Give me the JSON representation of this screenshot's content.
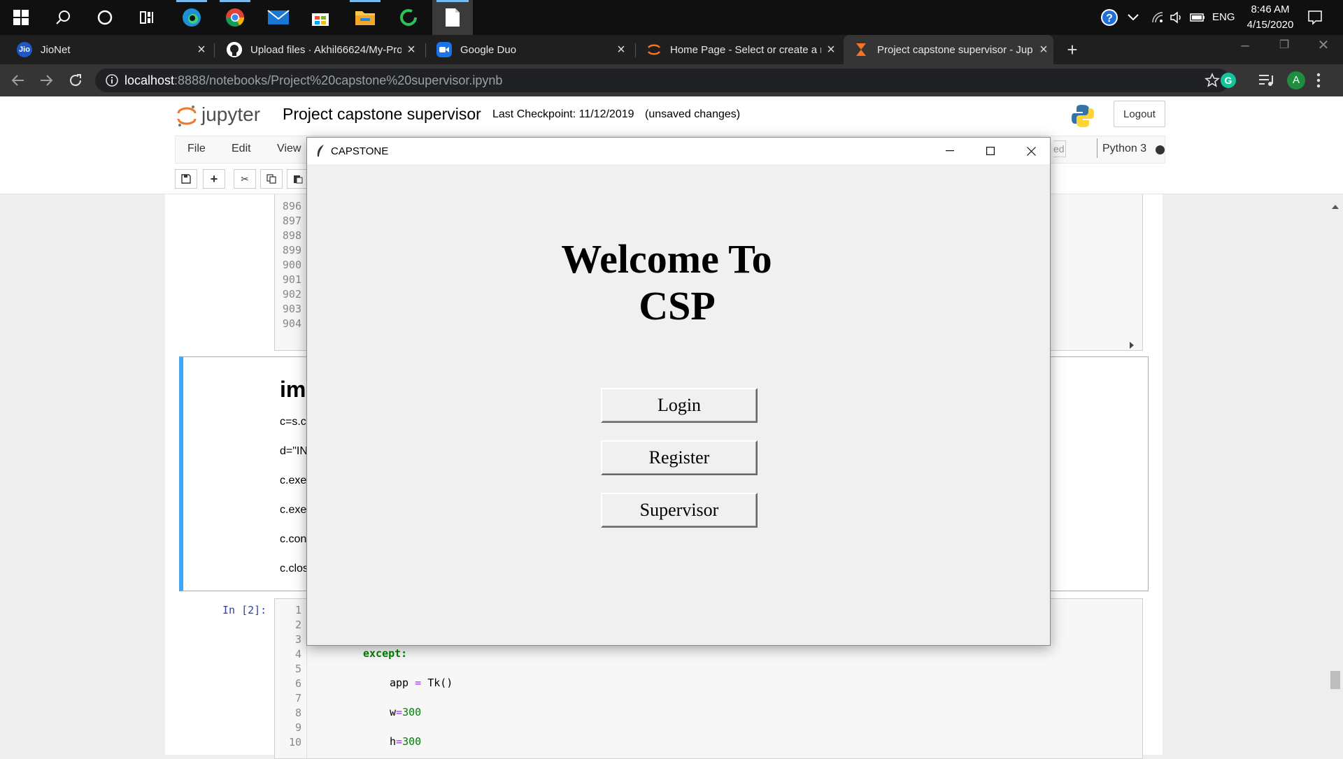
{
  "taskbar": {
    "clock_time": "8:46 AM",
    "clock_date": "4/15/2020",
    "language": "ENG"
  },
  "tabs": [
    {
      "label": "JioNet",
      "favicon": "Jio"
    },
    {
      "label": "Upload files · Akhil66624/My-Pro"
    },
    {
      "label": "Google Duo"
    },
    {
      "label": "Home Page - Select or create a n"
    },
    {
      "label": "Project capstone supervisor - Jup"
    }
  ],
  "address": {
    "host": "localhost",
    "path": ":8888/notebooks/Project%20capstone%20supervisor.ipynb"
  },
  "profile_initial": "A",
  "jupyter": {
    "logo_text": "jupyter",
    "notebook_title": "Project capstone supervisor",
    "checkpoint": "Last Checkpoint: 11/12/2019",
    "unsaved": "(unsaved changes)",
    "logout_label": "Logout",
    "menu": [
      "File",
      "Edit",
      "View"
    ],
    "trusted_fragment": "ed",
    "kernel_name": "Python 3"
  },
  "notebook": {
    "line_numbers_top": [
      "896",
      "897",
      "898",
      "899",
      "900",
      "901",
      "902",
      "903",
      "904"
    ],
    "markdown_heading": "im",
    "markdown_lines": [
      "c=s.c",
      "d=\"IN",
      "c.exe",
      "c.exe",
      "c.con",
      "c.clos"
    ],
    "prompt": "In [2]:",
    "line_numbers_bottom": [
      "1",
      "2",
      "3",
      "4",
      "5",
      "6",
      "7",
      "8",
      "9",
      "10"
    ],
    "code": {
      "except_kw": "except:",
      "app_var": "app",
      "assign": " = ",
      "tk_call": "Tk()",
      "w_var": "w",
      "w_val": "300",
      "h_var": "h",
      "h_val": "300",
      "equals": "="
    }
  },
  "tk_window": {
    "title": "CAPSTONE",
    "heading_line1": "Welcome To",
    "heading_line2": "CSP",
    "buttons": [
      "Login",
      "Register",
      "Supervisor"
    ]
  },
  "colors": {
    "jupyter_orange": "#f37626",
    "active_cell_blue": "#42a5f5",
    "code_keyword_green": "#008000"
  }
}
